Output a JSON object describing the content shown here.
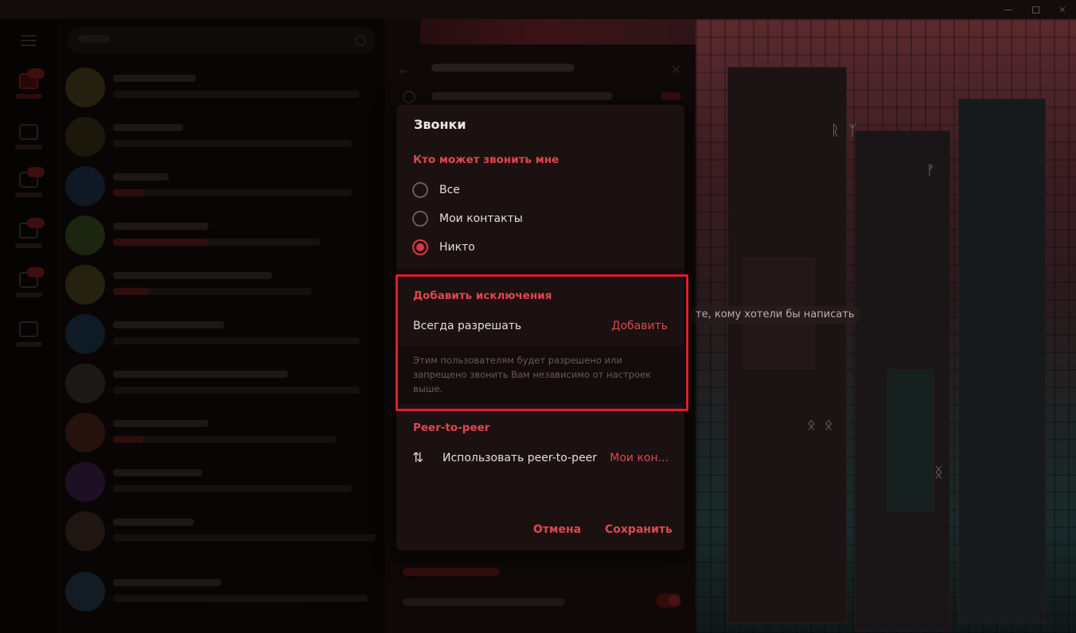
{
  "modal": {
    "title": "Звонки",
    "who_can_call": {
      "title": "Кто может звонить мне",
      "options": [
        {
          "label": "Все",
          "selected": false
        },
        {
          "label": "Мои контакты",
          "selected": false
        },
        {
          "label": "Никто",
          "selected": true
        }
      ]
    },
    "exceptions": {
      "title": "Добавить исключения",
      "always_allow_label": "Всегда разрешать",
      "add_label": "Добавить",
      "note": "Этим пользователям будет разрешено или запрещено звонить Вам независимо от настроек выше."
    },
    "p2p": {
      "title": "Peer-to-peer",
      "icon": "arrows-up-down-icon",
      "label": "Использовать peer-to-peer",
      "value": "Мои кон..."
    },
    "buttons": {
      "cancel": "Отмена",
      "save": "Сохранить"
    }
  },
  "wallpaper_hint": "те, кому хотели бы написать",
  "colors": {
    "accent": "#e0474d",
    "modal_bg": "#1b1111",
    "highlight": "#e01e26"
  }
}
